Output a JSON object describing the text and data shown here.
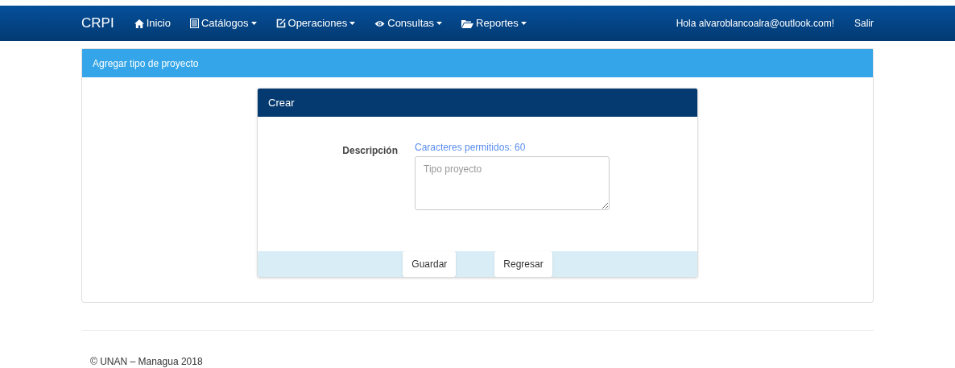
{
  "navbar": {
    "brand": "CRPI",
    "items": [
      {
        "label": "Inicio",
        "kind": "home",
        "dropdown": false
      },
      {
        "label": "Catálogos",
        "kind": "list",
        "dropdown": true
      },
      {
        "label": "Operaciones",
        "kind": "edit",
        "dropdown": true
      },
      {
        "label": "Consultas",
        "kind": "eye",
        "dropdown": true
      },
      {
        "label": "Reportes",
        "kind": "folder",
        "dropdown": true
      }
    ],
    "greeting": "Hola alvaroblancoalra@outlook.com!",
    "logout": "Salir"
  },
  "panel": {
    "title": "Agregar tipo de proyecto",
    "card": {
      "title": "Crear",
      "field_label": "Descripción",
      "hint": "Caracteres permitidos: 60",
      "placeholder": "Tipo proyecto",
      "buttons": [
        "Guardar",
        "Regresar"
      ]
    }
  },
  "footer": "© UNAN – Managua 2018"
}
